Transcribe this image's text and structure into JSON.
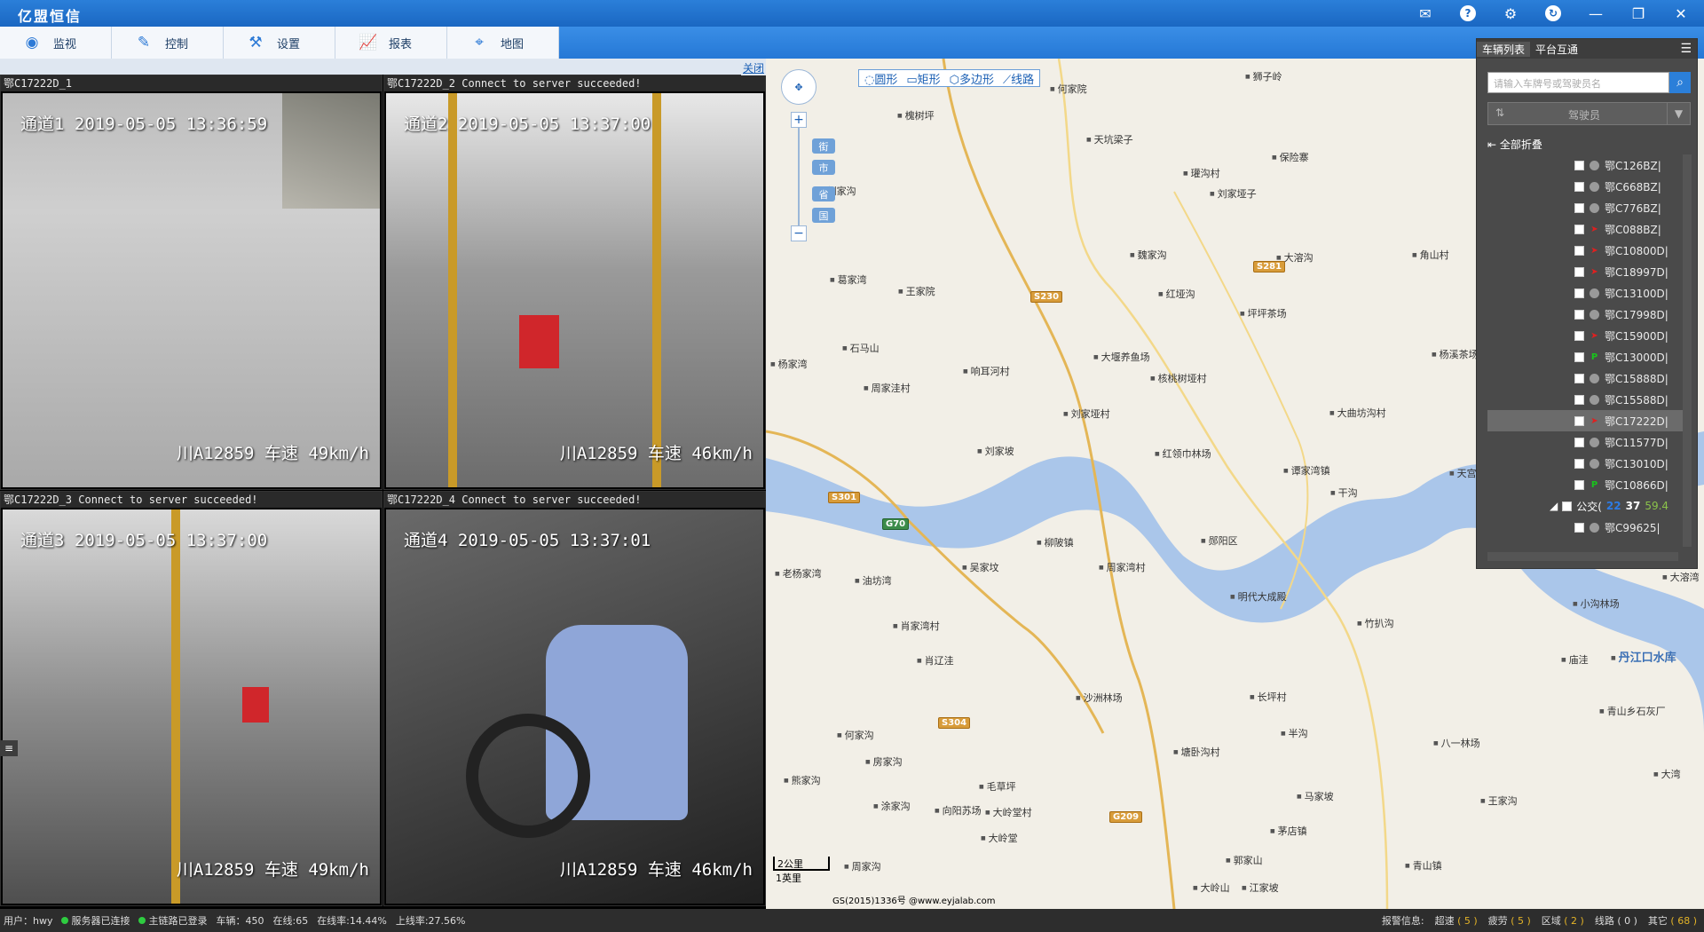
{
  "app": {
    "title": "亿盟恒信"
  },
  "nav": {
    "tabs": [
      {
        "label": "监视",
        "icon": "monitor-icon"
      },
      {
        "label": "控制",
        "icon": "control-icon"
      },
      {
        "label": "设置",
        "icon": "settings-icon"
      },
      {
        "label": "报表",
        "icon": "report-icon"
      },
      {
        "label": "地图",
        "icon": "map-icon"
      }
    ]
  },
  "video": {
    "close_label": "关闭",
    "channels": [
      {
        "header": "鄂C17222D_1",
        "timestamp": "通道1 2019-05-05 13:36:59",
        "plate_speed": "川A12859 车速 49km/h"
      },
      {
        "header": "鄂C17222D_2 Connect to server succeeded!",
        "timestamp": "通道2 2019-05-05 13:37:00",
        "plate_speed": "川A12859 车速 46km/h"
      },
      {
        "header": "鄂C17222D_3 Connect to server succeeded!",
        "timestamp": "通道3 2019-05-05 13:37:00",
        "plate_speed": "川A12859 车速 49km/h"
      },
      {
        "header": "鄂C17222D_4 Connect to server succeeded!",
        "timestamp": "通道4 2019-05-05 13:37:01",
        "plate_speed": "川A12859 车速 46km/h"
      }
    ]
  },
  "map": {
    "tools": [
      "圆形",
      "矩形",
      "多边形",
      "线路"
    ],
    "zoom_levels": [
      "街",
      "市",
      "省",
      "国"
    ],
    "scale": {
      "km": "2公里",
      "mile": "1英里"
    },
    "copyright": "GS(2015)1336号 @www.eyjalab.com",
    "places": [
      "狮子岭",
      "何家院",
      "槐树坪",
      "天坑梁子",
      "保险寨",
      "瓘沟村",
      "刘家垭子",
      "刘家沟",
      "魏家沟",
      "大溶沟",
      "角山村",
      "葛家湾",
      "王家院",
      "红垭沟",
      "坪坪茶场",
      "石马山",
      "大堰养鱼场",
      "杨溪茶场",
      "杨家湾",
      "响耳河村",
      "核桃树垭村",
      "周家洼村",
      "刘家垭村",
      "大曲坊沟村",
      "刘家坡",
      "红领巾林场",
      "谭家湾镇",
      "干沟",
      "柳陂镇",
      "老杨家湾",
      "油坊湾",
      "吴家坟",
      "周家湾村",
      "郧阳区",
      "明代大成殿",
      "竹扒沟",
      "肖家湾村",
      "肖辽洼",
      "沙洲林场",
      "长坪村",
      "小沟林场",
      "庙洼",
      "青山乡石灰厂",
      "何家沟",
      "半沟",
      "八一林场",
      "房家沟",
      "塘卧沟村",
      "熊家沟",
      "毛草坪",
      "马家坡",
      "王家沟",
      "涂家沟",
      "向阳苏场",
      "大岭堂村",
      "茅店镇",
      "大岭堂",
      "周家沟",
      "郭家山",
      "青山镇",
      "大岭山",
      "江家坡",
      "丹江口水库",
      "天宫",
      "大湾",
      "大溶湾"
    ],
    "roads": [
      "S230",
      "S281",
      "S301",
      "G70",
      "S304",
      "G209"
    ]
  },
  "panel": {
    "tabs": [
      "车辆列表",
      "平台互通"
    ],
    "search_placeholder": "请输入车牌号或驾驶员名",
    "sort_label": "驾驶员",
    "collapse_all": "全部折叠",
    "vehicles": [
      {
        "plate": "鄂C126BZ|",
        "status": "grey"
      },
      {
        "plate": "鄂C668BZ|",
        "status": "grey"
      },
      {
        "plate": "鄂C776BZ|",
        "status": "grey"
      },
      {
        "plate": "鄂C088BZ|",
        "status": "red"
      },
      {
        "plate": "鄂C10800D|",
        "status": "red"
      },
      {
        "plate": "鄂C18997D|",
        "status": "red"
      },
      {
        "plate": "鄂C13100D|",
        "status": "grey"
      },
      {
        "plate": "鄂C17998D|",
        "status": "grey"
      },
      {
        "plate": "鄂C15900D|",
        "status": "red"
      },
      {
        "plate": "鄂C13000D|",
        "status": "green"
      },
      {
        "plate": "鄂C15888D|",
        "status": "grey"
      },
      {
        "plate": "鄂C15588D|",
        "status": "grey"
      },
      {
        "plate": "鄂C17222D|",
        "status": "red",
        "selected": true
      },
      {
        "plate": "鄂C11577D|",
        "status": "grey"
      },
      {
        "plate": "鄂C13010D|",
        "status": "grey"
      },
      {
        "plate": "鄂C10866D|",
        "status": "green"
      }
    ],
    "group": {
      "name": "公交(",
      "online": "22",
      "total": "37",
      "pct": "59.4"
    },
    "after_group": [
      {
        "plate": "鄂C99625|",
        "status": "grey"
      }
    ]
  },
  "status": {
    "user": "用户：hwy",
    "server": "服务器已连接",
    "link": "主链路已登录",
    "vehicles": "车辆：450",
    "online": "在线:65",
    "online_rate": "在线率:14.44%",
    "online_up_rate": "上线率:27.56%",
    "alarm_info": "报警信息:",
    "alarms": [
      {
        "label": "超速",
        "count": "( 5 )"
      },
      {
        "label": "疲劳",
        "count": "( 5 )"
      },
      {
        "label": "区域",
        "count": "( 2 )"
      },
      {
        "label": "线路",
        "count": "( 0 )"
      },
      {
        "label": "其它",
        "count": "( 68 )"
      }
    ]
  }
}
